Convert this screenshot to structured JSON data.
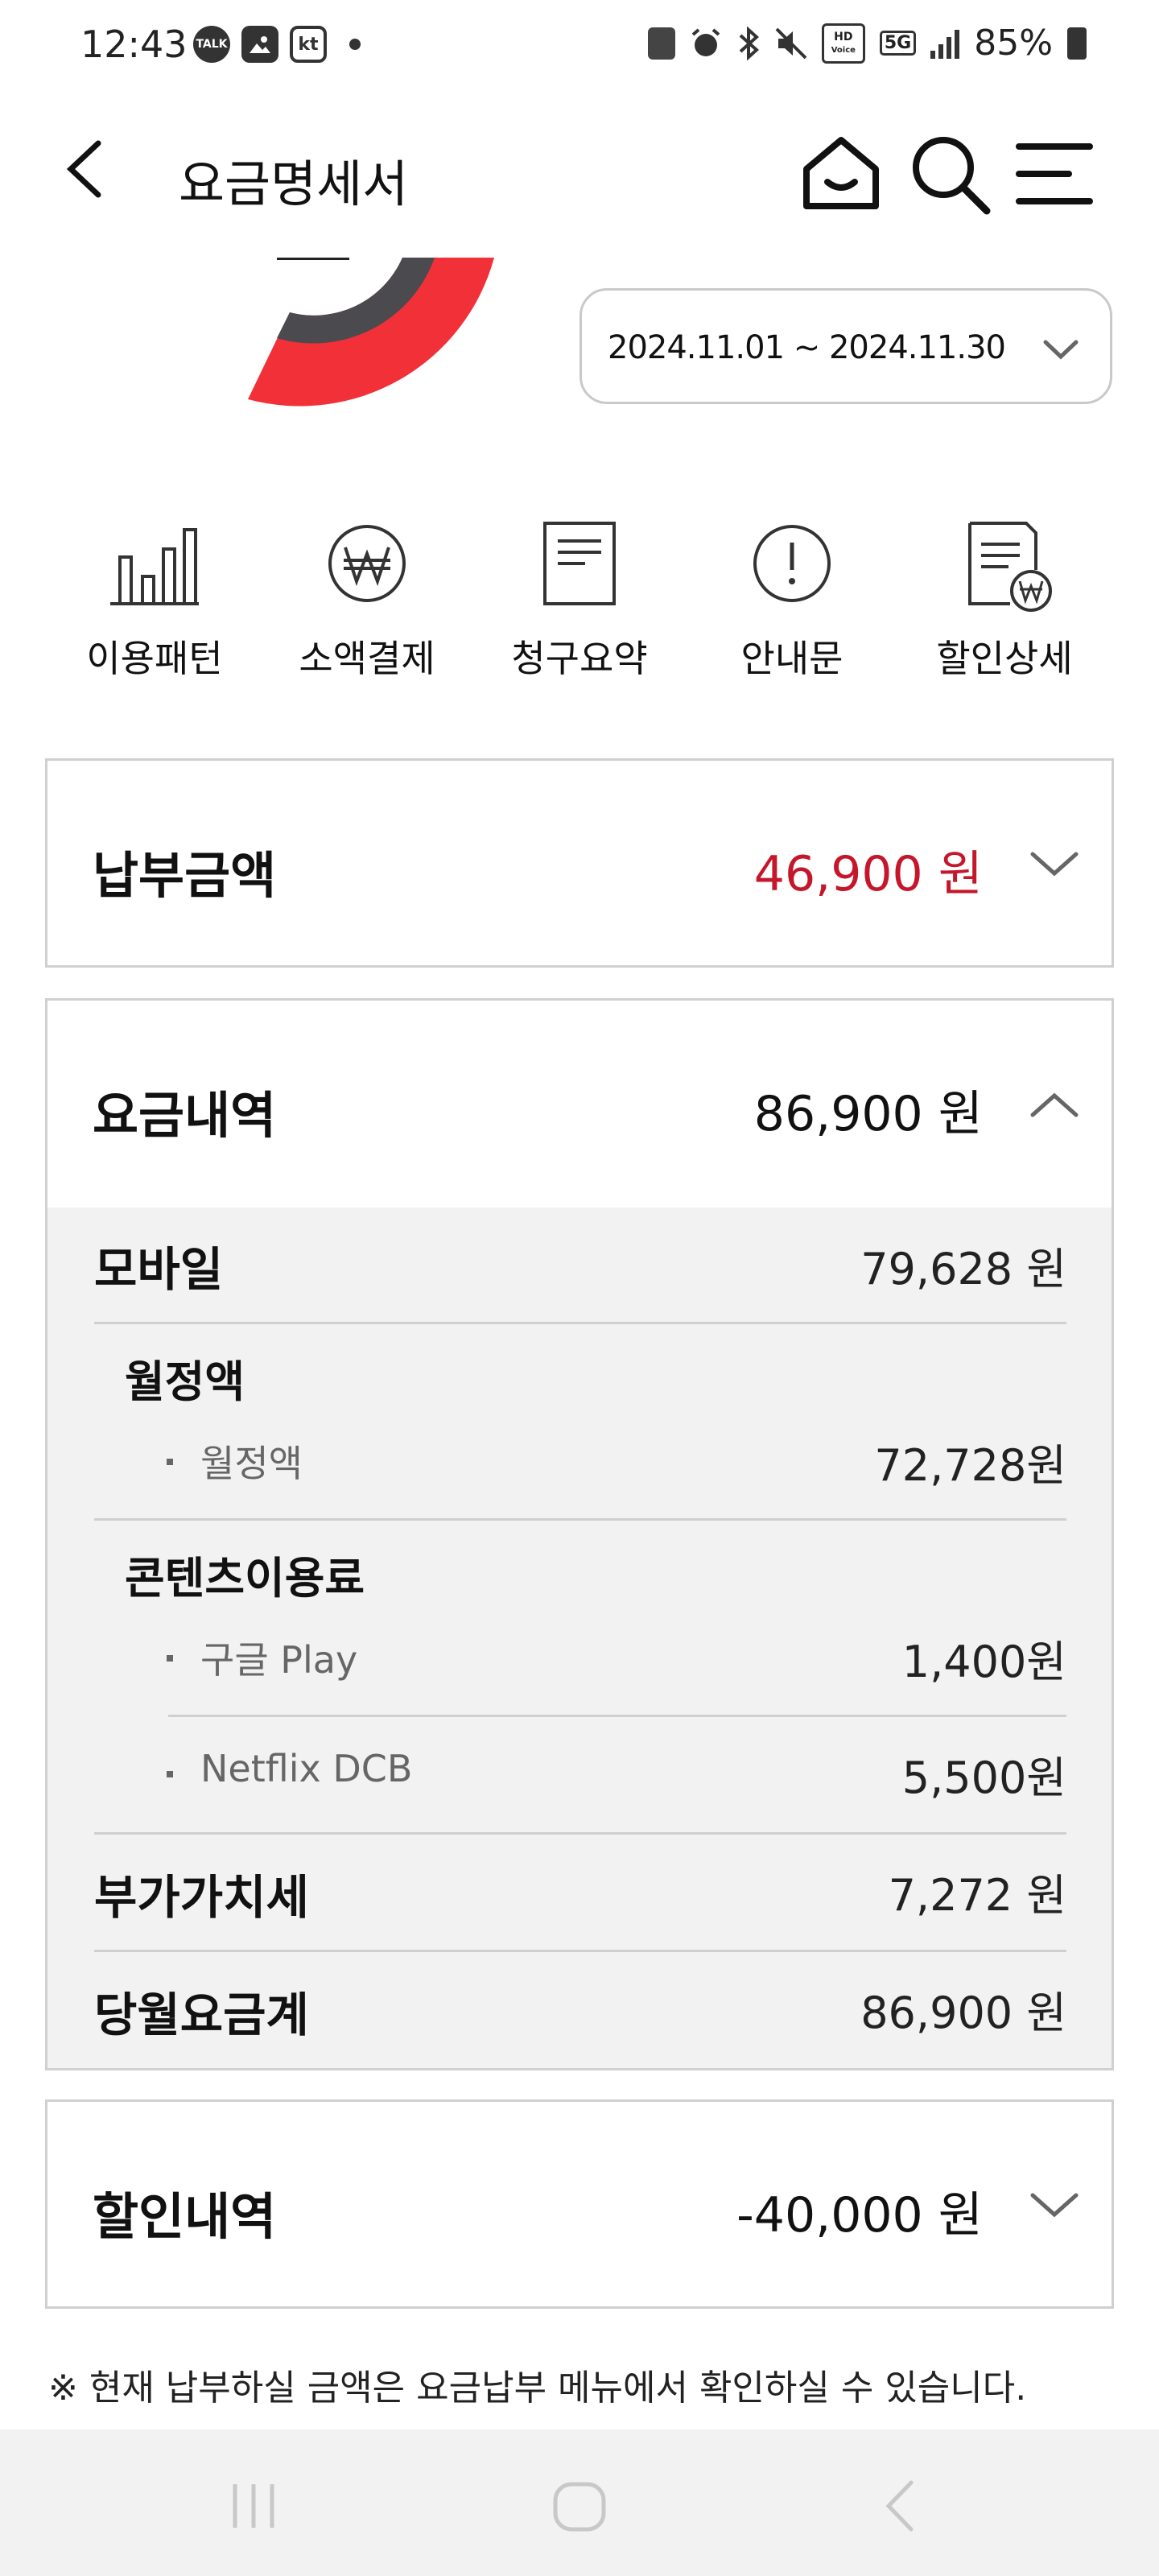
{
  "status_bar": {
    "time": "12:43",
    "left_icons": [
      "kakaotalk-notification-icon",
      "gallery-notification-icon",
      "kt-notification-icon",
      "more-notifications-dot"
    ],
    "kt_label": "kt",
    "talk_label": "TALK",
    "right_icons": [
      "battery-saver-icon",
      "alarm-icon",
      "bluetooth-icon",
      "mute-icon",
      "hd-voice-icon",
      "5g-icon",
      "signal-icon",
      "battery-icon"
    ],
    "hd_label": "HD",
    "voice_label": "Voice",
    "net_label": "5G",
    "battery": "85%"
  },
  "header": {
    "title": "요금명세서",
    "icons": [
      "back-arrow-icon",
      "home-icon",
      "search-icon",
      "menu-icon"
    ]
  },
  "period": {
    "value": "2024.11.01 ~ 2024.11.30"
  },
  "quick_menu": [
    {
      "label": "이용패턴",
      "icon": "bar-chart-icon"
    },
    {
      "label": "소액결제",
      "icon": "won-circle-icon"
    },
    {
      "label": "청구요약",
      "icon": "document-icon"
    },
    {
      "label": "안내문",
      "icon": "exclamation-circle-icon"
    },
    {
      "label": "할인상세",
      "icon": "discount-document-icon"
    }
  ],
  "payment": {
    "title": "납부금액",
    "amount": "46,900 원"
  },
  "charges": {
    "title": "요금내역",
    "amount": "86,900 원",
    "mobile_label": "모바일",
    "mobile_amount": "79,628 원",
    "monthly_group": "월정액",
    "monthly_item": "월정액",
    "monthly_amount": "72,728원",
    "content_group": "콘텐츠이용료",
    "google_item": "구글 Play",
    "google_amount": "1,400원",
    "netflix_item": "Netflix DCB",
    "netflix_amount": "5,500원",
    "vat_label": "부가가치세",
    "vat_amount": "7,272 원",
    "total_label": "당월요금계",
    "total_amount": "86,900 원"
  },
  "discount": {
    "title": "할인내역",
    "amount": "-40,000 원"
  },
  "notice": "※ 현재 납부하실 금액은 요금납부 메뉴에서 확인하실 수 있습니다.",
  "colors": {
    "accent_red": "#c5172b",
    "chart_red": "#f23038",
    "chart_dark": "#4a4a4f"
  }
}
